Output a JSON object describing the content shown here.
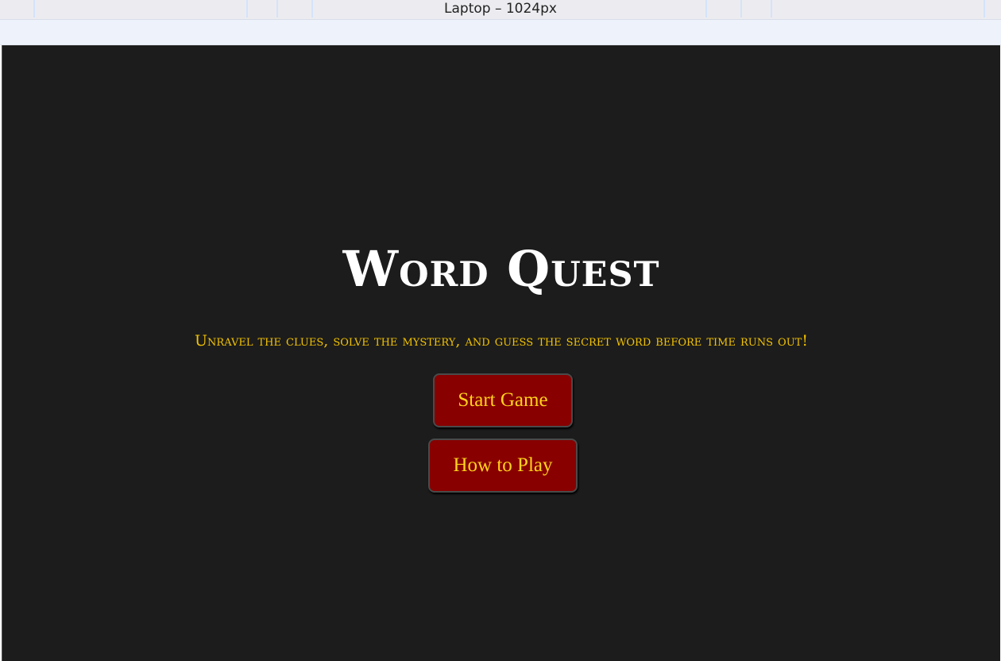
{
  "devtools": {
    "viewport_label": "Laptop – 1024px"
  },
  "game": {
    "title": "Word Quest",
    "tagline": "Unravel the clues, solve the mystery, and guess the secret word before time runs out!",
    "buttons": {
      "start": "Start Game",
      "how_to_play": "How to Play"
    }
  },
  "colors": {
    "background": "#1c1c1c",
    "title": "#ffffff",
    "tagline": "#f2c200",
    "button_bg": "#880000",
    "button_text": "#ffd21a"
  }
}
